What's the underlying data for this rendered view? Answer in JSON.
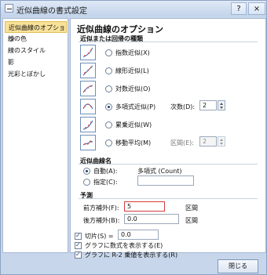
{
  "window": {
    "title": "近似曲線の書式設定",
    "help": "?",
    "close": "×"
  },
  "sidebar": {
    "items": [
      "近似曲線のオプション",
      "線の色",
      "線のスタイル",
      "影",
      "光彩とぼかし"
    ]
  },
  "main": {
    "title": "近似曲線のオプション",
    "section_type": "近似または回帰の種類",
    "types": [
      {
        "label": "指数近似(X)",
        "selected": false
      },
      {
        "label": "線形近似(L)",
        "selected": false
      },
      {
        "label": "対数近似(O)",
        "selected": false
      },
      {
        "label": "多項式近似(P)",
        "selected": true
      },
      {
        "label": "累乗近似(W)",
        "selected": false
      },
      {
        "label": "移動平均(M)",
        "selected": false
      }
    ],
    "order_label": "次数(D):",
    "order_value": "2",
    "period_label": "区間(E):",
    "period_value": "2",
    "section_name": "近似曲線名",
    "auto_label": "自動(A):",
    "auto_value": "多項式 (Count)",
    "custom_label": "指定(C):",
    "section_forecast": "予測",
    "forward_label": "前方補外(F):",
    "forward_value": "5",
    "backward_label": "後方補外(B):",
    "backward_value": "0.0",
    "unit_label": "区間",
    "intercept_label": "切片(S) =",
    "intercept_value": "0.0",
    "show_equation_label": "グラフに数式を表示する(E)",
    "show_r2_label": "グラフに R-2 乗値を表示する(R)"
  },
  "footer": {
    "close_label": "閉じる"
  }
}
